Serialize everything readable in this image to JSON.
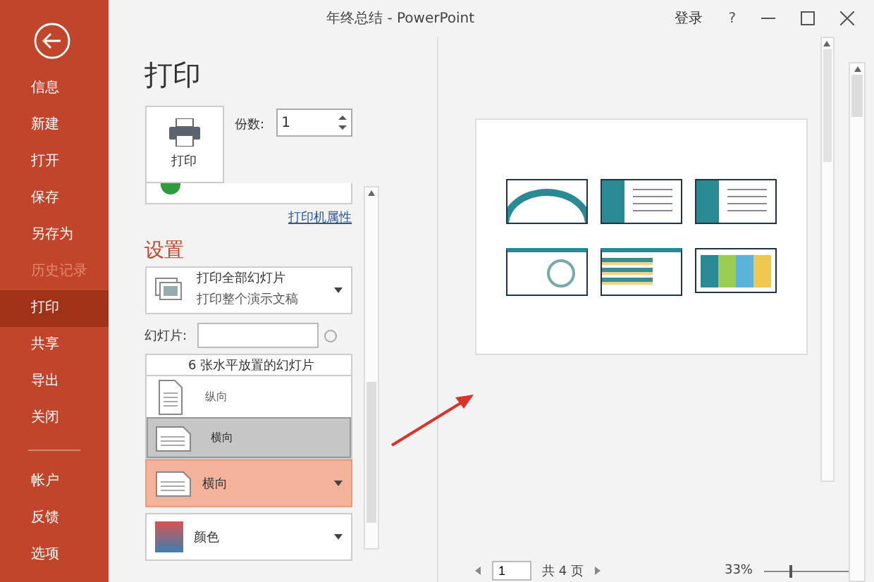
{
  "window": {
    "title": "年终总结 - PowerPoint",
    "sign_in": "登录",
    "help": "?"
  },
  "sidebar": {
    "items": [
      {
        "label": "信息",
        "selected": false,
        "disabled": false
      },
      {
        "label": "新建",
        "selected": false,
        "disabled": false
      },
      {
        "label": "打开",
        "selected": false,
        "disabled": false
      },
      {
        "label": "保存",
        "selected": false,
        "disabled": false
      },
      {
        "label": "另存为",
        "selected": false,
        "disabled": false
      },
      {
        "label": "历史记录",
        "selected": false,
        "disabled": true
      },
      {
        "label": "打印",
        "selected": true,
        "disabled": false
      },
      {
        "label": "共享",
        "selected": false,
        "disabled": false
      },
      {
        "label": "导出",
        "selected": false,
        "disabled": false
      },
      {
        "label": "关闭",
        "selected": false,
        "disabled": false
      }
    ],
    "footer_items": [
      {
        "label": "帐户",
        "selected": false,
        "disabled": false
      },
      {
        "label": "反馈",
        "selected": false,
        "disabled": false
      },
      {
        "label": "选项",
        "selected": false,
        "disabled": false
      }
    ]
  },
  "print": {
    "heading": "打印",
    "button": "打印",
    "copies_label": "份数:",
    "copies": "1",
    "printer_properties": "打印机属性"
  },
  "settings": {
    "heading": "设置",
    "slides_label": "幻灯片:",
    "range": {
      "title": "打印全部幻灯片",
      "subtitle": "打印整个演示文稿"
    },
    "layout": {
      "title": "6 张水平放置的幻灯片"
    },
    "orientation_menu": [
      {
        "label": "纵向",
        "kind": "portrait",
        "selected": false
      },
      {
        "label": "横向",
        "kind": "landscape",
        "selected": true
      }
    ],
    "orientation": {
      "label": "横向",
      "highlighted": true
    },
    "color": {
      "label": "颜色"
    }
  },
  "preview": {
    "page": "1",
    "total": "共 4 页",
    "zoom": "33%",
    "zoom_slider": {
      "level": 0.3
    }
  }
}
